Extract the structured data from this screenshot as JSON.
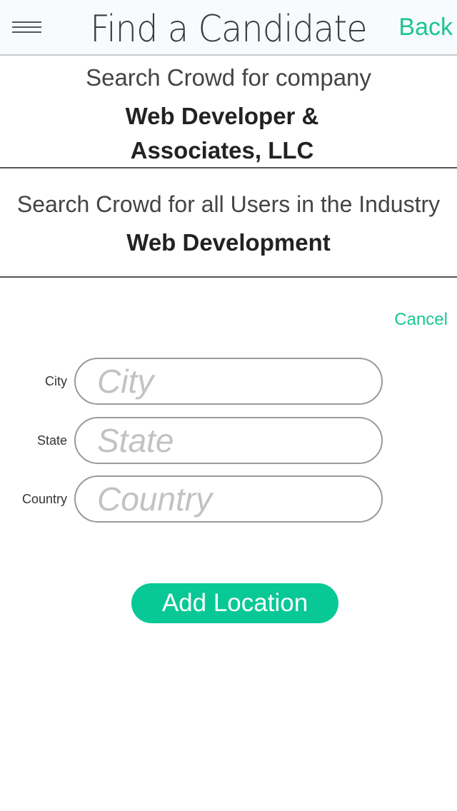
{
  "header": {
    "title": "Find a Candidate",
    "back_label": "Back",
    "menu_icon": "hamburger-menu-icon"
  },
  "company_section": {
    "label": "Search Crowd for company",
    "value": "Web Developer & Associates, LLC"
  },
  "industry_section": {
    "label": "Search Crowd for all Users in the Industry",
    "value": "Web Development"
  },
  "location_form": {
    "cancel_label": "Cancel",
    "fields": {
      "city": {
        "label": "City",
        "placeholder": "City",
        "value": ""
      },
      "state": {
        "label": "State",
        "placeholder": "State",
        "value": ""
      },
      "country": {
        "label": "Country",
        "placeholder": "Country",
        "value": ""
      }
    },
    "submit_label": "Add Location"
  },
  "colors": {
    "accent": "#1cc593",
    "button": "#08c896",
    "header_bg": "#f7fbfd"
  }
}
